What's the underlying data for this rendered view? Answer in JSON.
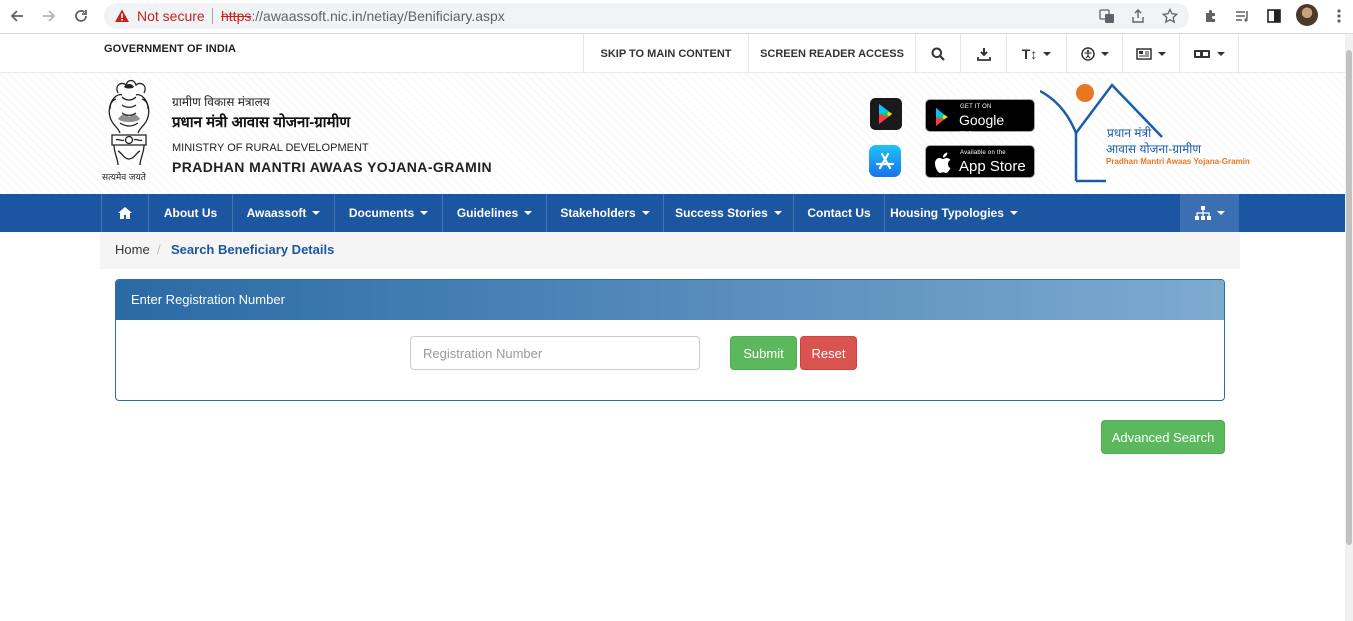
{
  "browser": {
    "security_label": "Not secure",
    "url_protocol": "https",
    "url_rest": "://awaassoft.nic.in/netiay/Benificiary.aspx"
  },
  "topbar": {
    "gov_label": "GOVERNMENT OF INDIA",
    "skip_label": "SKIP TO MAIN CONTENT",
    "screen_reader_label": "SCREEN READER ACCESS",
    "text_size_label": "T↕"
  },
  "header": {
    "ministry_hi": "ग्रामीण विकास मंत्रालय",
    "scheme_hi": "प्रधान मंत्री आवास योजना-ग्रामीण",
    "ministry_en": "MINISTRY OF RURAL DEVELOPMENT",
    "scheme_en": "PRADHAN MANTRI AWAAS YOJANA-GRAMIN",
    "emblem_caption": "सत्यमेव जयते",
    "google_play_small": "GET IT ON",
    "google_play_big": "Google Play",
    "app_store_small": "Available on the",
    "app_store_big": "App Store",
    "logo_line1": "प्रधान मंत्री",
    "logo_line2": "आवास योजना-ग्रामीण",
    "logo_line3": "Pradhan Mantri Awaas Yojana-Gramin"
  },
  "nav": {
    "about": "About Us",
    "awaassoft": "Awaassoft",
    "documents": "Documents",
    "guidelines": "Guidelines",
    "stakeholders": "Stakeholders",
    "success": "Success Stories",
    "contact": "Contact Us",
    "housing": "Housing Typologies"
  },
  "breadcrumb": {
    "home": "Home",
    "sep": "/",
    "current": "Search Beneficiary Details"
  },
  "form": {
    "panel_title": "Enter Registration Number",
    "placeholder": "Registration Number",
    "submit": "Submit",
    "reset": "Reset",
    "advanced": "Advanced Search"
  },
  "colors": {
    "nav_blue": "#1d56a0",
    "success_green": "#5cb85c",
    "danger_red": "#d9534f",
    "logo_orange": "#e87722"
  }
}
